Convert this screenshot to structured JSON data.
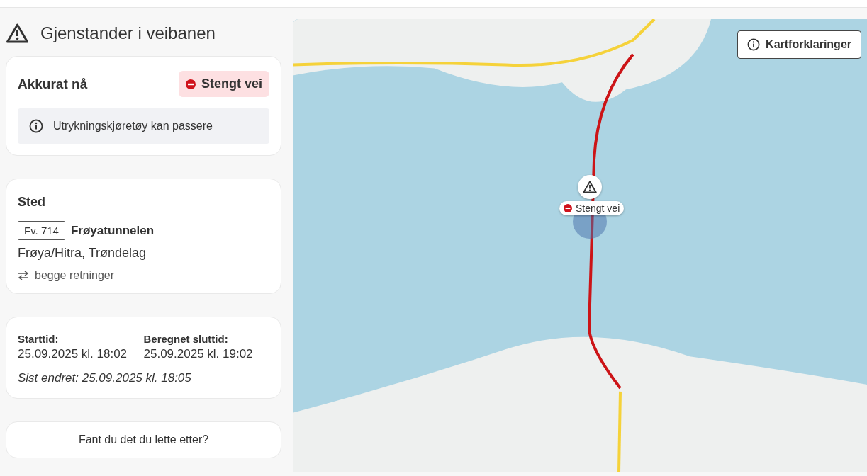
{
  "page_title": "Gjenstander i veibanen",
  "current": {
    "heading": "Akkurat nå",
    "status": {
      "kind": "closed",
      "label": "Stengt vei"
    },
    "notice": "Utrykningskjøretøy kan passere"
  },
  "location": {
    "heading": "Sted",
    "road_number": "Fv. 714",
    "road_name": "Frøyatunnelen",
    "area": "Frøya/Hitra, Trøndelag",
    "direction": "begge retninger"
  },
  "times": {
    "start_label": "Starttid:",
    "start_value": "25.09.2025 kl. 18:02",
    "end_label": "Beregnet sluttid:",
    "end_value": "25.09.2025 kl. 19:02",
    "last_changed": "Sist endret: 25.09.2025 kl. 18:05"
  },
  "feedback": {
    "question": "Fant du det du lette etter?"
  },
  "map": {
    "legend_button": "Kartforklaringer",
    "marker": {
      "kind": "closed",
      "label": "Stengt vei"
    }
  }
}
